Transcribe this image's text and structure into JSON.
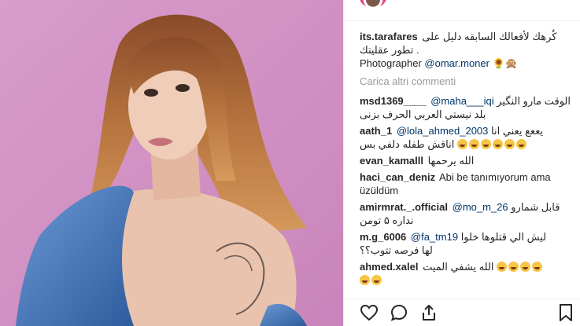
{
  "post": {
    "caption": {
      "username": "its.tarafares",
      "text_line1": "كُرهك لأفعالك السابقه دليل على",
      "text_line2": ". تطور عقليتك",
      "photographer_label": "Photographer",
      "photographer_mention": "@omar.moner"
    },
    "load_more": "Carica altri commenti",
    "comments": [
      {
        "username": "msd1369____",
        "mention": "@maha___iqi",
        "text1": "الوقت مارو النگير",
        "text2": "بلد نيستي العربي الحرف بزنى"
      },
      {
        "username": "aath_1",
        "mention": "@lola_ahmed_2003",
        "text1": "يععع يعني انا",
        "text2": "اناقش طفله دلفي بس"
      },
      {
        "username": "evan_kamalll",
        "text1": "الله يرحمها"
      },
      {
        "username": "haci_can_deniz",
        "text1": "Abi be tanımıyorum ama",
        "text2": "üzüldüm"
      },
      {
        "username": "amirmrat._.official",
        "mention": "@mo_m_26",
        "text1": "قابل شمارو",
        "text2": "نداره ۵ تومن"
      },
      {
        "username": "m.g_6006",
        "mention": "@fa_tm19",
        "text1": "ليش الي قتلوها خلوا",
        "text2": "لها فرصه تتوب؟؟"
      },
      {
        "username": "ahmed.xalel",
        "text1": "الله يشفي الميت"
      }
    ]
  },
  "actions": {
    "like": "heart-icon",
    "comment": "comment-icon",
    "share": "share-icon",
    "save": "bookmark-icon"
  },
  "colors": {
    "photo_background": "#d48fc2",
    "mention": "#003569",
    "muted": "#999999"
  }
}
